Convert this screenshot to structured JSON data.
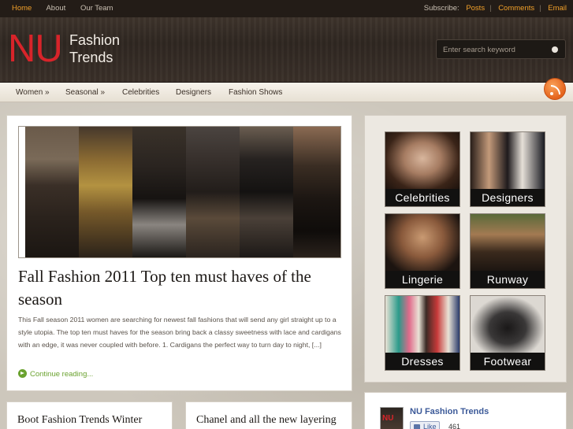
{
  "top_nav": {
    "items": [
      {
        "label": "Home",
        "active": true
      },
      {
        "label": "About",
        "active": false
      },
      {
        "label": "Our Team",
        "active": false
      }
    ]
  },
  "subscribe": {
    "label": "Subscribe:",
    "links": [
      "Posts",
      "Comments",
      "Email"
    ]
  },
  "logo": {
    "mark": "NU",
    "line1": "Fashion",
    "line2": "Trends"
  },
  "search": {
    "placeholder": "Enter search keyword"
  },
  "main_nav": {
    "items": [
      "Women »",
      "Seasonal »",
      "Celebrities",
      "Designers",
      "Fashion Shows"
    ]
  },
  "featured_post": {
    "title": "Fall Fashion 2011 Top ten must haves of the season",
    "excerpt": "This Fall season 2011 women are  searching for newest  fall fashions that will send any girl straight up  to a style utopia. The top ten must haves for the season bring back a classy sweetness with lace and cardigans with an edge, it was never coupled with before. 1. Cardigans the perfect way to turn day to night, [...]",
    "continue_label": "Continue reading..."
  },
  "more_posts": [
    {
      "title": "Boot Fashion Trends Winter"
    },
    {
      "title": "Chanel and all the new layering"
    }
  ],
  "categories": [
    {
      "label": "Celebrities"
    },
    {
      "label": "Designers"
    },
    {
      "label": "Lingerie"
    },
    {
      "label": "Runway"
    },
    {
      "label": "Dresses"
    },
    {
      "label": "Footwear"
    }
  ],
  "facebook": {
    "page_name": "NU Fashion Trends",
    "like_label": "Like",
    "count": "461",
    "thumb_text": "NU"
  },
  "colors": {
    "accent_orange": "#f1a02a",
    "logo_red": "#d8242a",
    "link_green": "#6aa22f",
    "facebook_blue": "#3b5998"
  },
  "icons": [
    "rss-icon",
    "search-icon",
    "continue-arrow-icon",
    "like-thumb-icon"
  ]
}
